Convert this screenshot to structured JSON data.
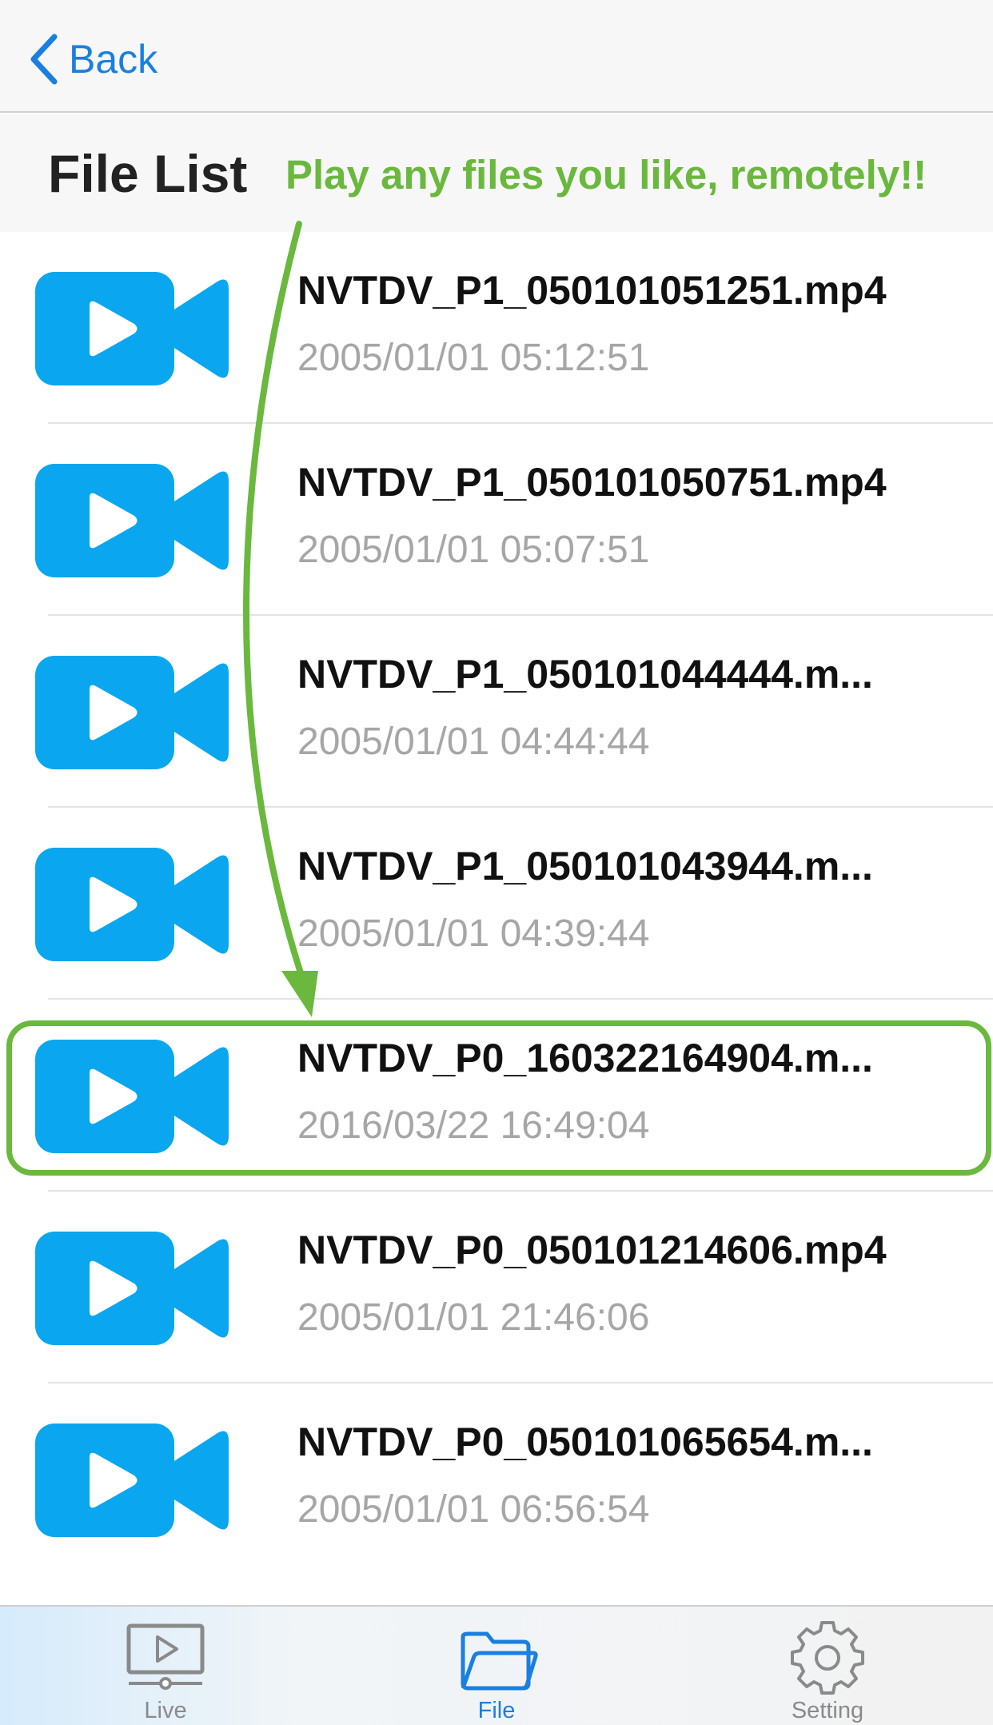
{
  "navbar": {
    "back_label": "Back"
  },
  "header": {
    "title": "File List",
    "promo": "Play any files you like, remotely!!"
  },
  "files": [
    {
      "name": "NVTDV_P1_050101051251.mp4",
      "date": "2005/01/01 05:12:51"
    },
    {
      "name": "NVTDV_P1_050101050751.mp4",
      "date": "2005/01/01 05:07:51"
    },
    {
      "name": "NVTDV_P1_050101044444.m...",
      "date": "2005/01/01 04:44:44"
    },
    {
      "name": "NVTDV_P1_050101043944.m...",
      "date": "2005/01/01 04:39:44"
    },
    {
      "name": "NVTDV_P0_160322164904.m...",
      "date": "2016/03/22 16:49:04",
      "highlighted": true
    },
    {
      "name": "NVTDV_P0_050101214606.mp4",
      "date": "2005/01/01 21:46:06"
    },
    {
      "name": "NVTDV_P0_050101065654.m...",
      "date": "2005/01/01 06:56:54"
    }
  ],
  "tabs": [
    {
      "label": "Live",
      "icon": "monitor-play-icon",
      "active": false
    },
    {
      "label": "File",
      "icon": "folder-icon",
      "active": true
    },
    {
      "label": "Setting",
      "icon": "gear-icon",
      "active": false
    }
  ],
  "colors": {
    "accent": "#1a7fe0",
    "video_icon": "#0aa6f0",
    "highlight": "#6ab83d"
  }
}
